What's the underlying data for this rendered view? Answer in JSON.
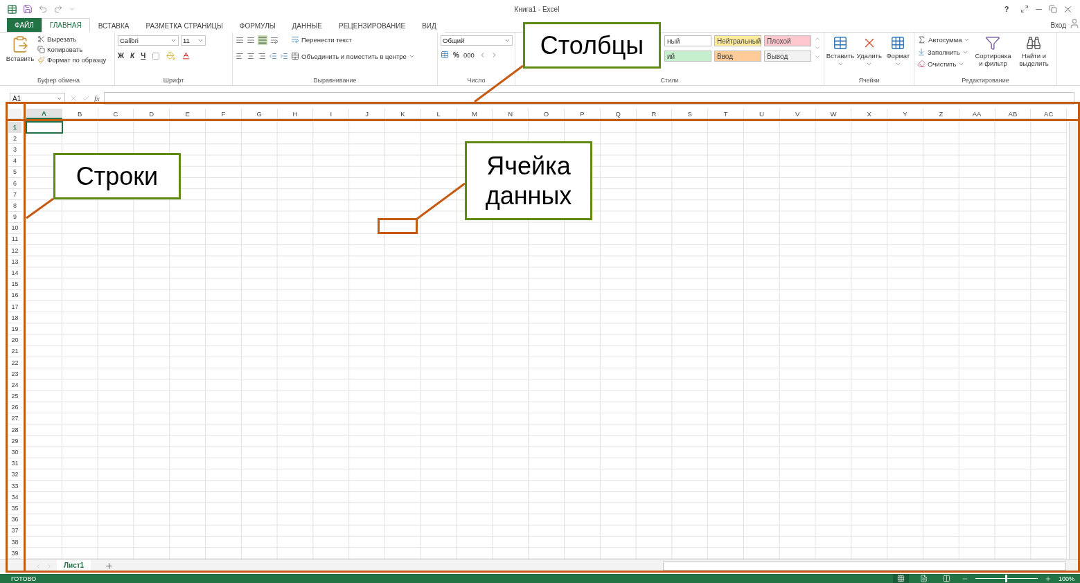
{
  "window": {
    "title": "Книга1 - Excel",
    "help": "?",
    "sign_in": "Вход"
  },
  "tabs": [
    {
      "label": "ФАЙЛ",
      "kind": "file",
      "selected": false
    },
    {
      "label": "ГЛАВНАЯ",
      "kind": "tab",
      "selected": true
    },
    {
      "label": "ВСТАВКА",
      "kind": "tab",
      "selected": false
    },
    {
      "label": "РАЗМЕТКА СТРАНИЦЫ",
      "kind": "tab",
      "selected": false
    },
    {
      "label": "ФОРМУЛЫ",
      "kind": "tab",
      "selected": false
    },
    {
      "label": "ДАННЫЕ",
      "kind": "tab",
      "selected": false
    },
    {
      "label": "РЕЦЕНЗИРОВАНИЕ",
      "kind": "tab",
      "selected": false
    },
    {
      "label": "ВИД",
      "kind": "tab",
      "selected": false
    }
  ],
  "clipboard": {
    "paste": "Вставить",
    "cut": "Вырезать",
    "copy": "Копировать",
    "format_painter": "Формат по образцу",
    "label": "Буфер обмена"
  },
  "font": {
    "name": "Calibri",
    "size": "11",
    "bold": "Ж",
    "italic": "К",
    "underline": "Ч",
    "label": "Шрифт"
  },
  "alignment": {
    "wrap": "Перенести текст",
    "merge": "Объединить и поместить в центре",
    "label": "Выравнивание"
  },
  "number": {
    "format": "Общий",
    "percent": "%",
    "thousands": "000",
    "label": "Число"
  },
  "styles": {
    "label": "Стили",
    "gallery": [
      {
        "label": "ный",
        "color": "#ffffff"
      },
      {
        "label": "Нейтральный",
        "color": "#ffeb9c"
      },
      {
        "label": "Плохой",
        "color": "#ffc7ce"
      },
      {
        "label": "ий",
        "color": "#c6efce"
      },
      {
        "label": "Ввод",
        "color": "#ffcc99"
      },
      {
        "label": "Вывод",
        "color": "#f2f2f2"
      }
    ]
  },
  "cells": {
    "insert": "Вставить",
    "delete": "Удалить",
    "format": "Формат",
    "label": "Ячейки"
  },
  "editing": {
    "autosum": "Автосумма",
    "fill": "Заполнить",
    "clear": "Очистить",
    "sort": "Сортировка и фильтр",
    "find": "Найти и выделить",
    "label": "Редактирование"
  },
  "formula_bar": {
    "name_box": "A1",
    "fx": "fx"
  },
  "columns": [
    {
      "label": "A",
      "selected": true
    },
    {
      "label": "B",
      "selected": false
    },
    {
      "label": "C",
      "selected": false
    },
    {
      "label": "D",
      "selected": false
    },
    {
      "label": "E",
      "selected": false
    },
    {
      "label": "F",
      "selected": false
    },
    {
      "label": "G",
      "selected": false
    },
    {
      "label": "H",
      "selected": false
    },
    {
      "label": "I",
      "selected": false
    },
    {
      "label": "J",
      "selected": false
    },
    {
      "label": "K",
      "selected": false
    },
    {
      "label": "L",
      "selected": false
    },
    {
      "label": "M",
      "selected": false
    },
    {
      "label": "N",
      "selected": false
    },
    {
      "label": "O",
      "selected": false
    },
    {
      "label": "P",
      "selected": false
    },
    {
      "label": "Q",
      "selected": false
    },
    {
      "label": "R",
      "selected": false
    },
    {
      "label": "S",
      "selected": false
    },
    {
      "label": "T",
      "selected": false
    },
    {
      "label": "U",
      "selected": false
    },
    {
      "label": "V",
      "selected": false
    },
    {
      "label": "W",
      "selected": false
    },
    {
      "label": "X",
      "selected": false
    },
    {
      "label": "Y",
      "selected": false
    },
    {
      "label": "Z",
      "selected": false
    },
    {
      "label": "AA",
      "selected": false
    },
    {
      "label": "AB",
      "selected": false
    },
    {
      "label": "AC",
      "selected": false
    }
  ],
  "rows": [
    {
      "label": "1",
      "selected": true
    },
    {
      "label": "2",
      "selected": false
    },
    {
      "label": "3",
      "selected": false
    },
    {
      "label": "4",
      "selected": false
    },
    {
      "label": "5",
      "selected": false
    },
    {
      "label": "6",
      "selected": false
    },
    {
      "label": "7",
      "selected": false
    },
    {
      "label": "8",
      "selected": false
    },
    {
      "label": "9",
      "selected": false
    },
    {
      "label": "10",
      "selected": false
    },
    {
      "label": "11",
      "selected": false
    },
    {
      "label": "12",
      "selected": false
    },
    {
      "label": "13",
      "selected": false
    },
    {
      "label": "14",
      "selected": false
    },
    {
      "label": "15",
      "selected": false
    },
    {
      "label": "16",
      "selected": false
    },
    {
      "label": "17",
      "selected": false
    },
    {
      "label": "18",
      "selected": false
    },
    {
      "label": "19",
      "selected": false
    },
    {
      "label": "20",
      "selected": false
    },
    {
      "label": "21",
      "selected": false
    },
    {
      "label": "22",
      "selected": false
    },
    {
      "label": "23",
      "selected": false
    },
    {
      "label": "24",
      "selected": false
    },
    {
      "label": "25",
      "selected": false
    },
    {
      "label": "26",
      "selected": false
    },
    {
      "label": "27",
      "selected": false
    },
    {
      "label": "28",
      "selected": false
    },
    {
      "label": "29",
      "selected": false
    },
    {
      "label": "30",
      "selected": false
    },
    {
      "label": "31",
      "selected": false
    },
    {
      "label": "32",
      "selected": false
    },
    {
      "label": "33",
      "selected": false
    },
    {
      "label": "34",
      "selected": false
    },
    {
      "label": "35",
      "selected": false
    },
    {
      "label": "36",
      "selected": false
    },
    {
      "label": "37",
      "selected": false
    },
    {
      "label": "38",
      "selected": false
    },
    {
      "label": "39",
      "selected": false
    }
  ],
  "sheets": [
    {
      "label": "Лист1",
      "selected": true
    }
  ],
  "status_bar": {
    "text": "ГОТОВО",
    "views": [
      {
        "kind": "normal",
        "selected": true
      },
      {
        "kind": "layout",
        "selected": false
      },
      {
        "kind": "pagebreak",
        "selected": false
      }
    ],
    "zoom": {
      "level": 0.5,
      "reading": "100%"
    }
  },
  "annotations": [
    {
      "kind": "columns",
      "text": "Столбцы"
    },
    {
      "kind": "rows",
      "text": "Строки"
    },
    {
      "kind": "cell",
      "text": "Ячейка данных"
    }
  ]
}
